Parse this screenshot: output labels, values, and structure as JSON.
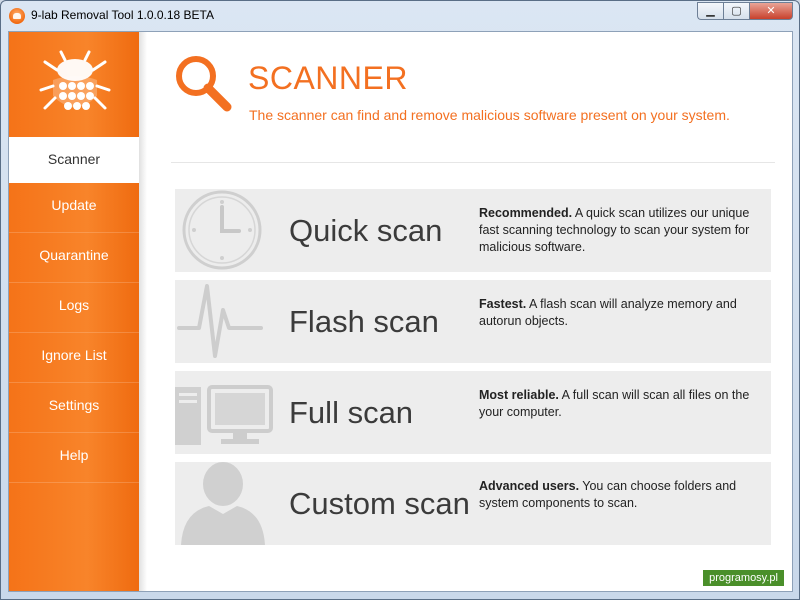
{
  "window": {
    "title": "9-lab Removal Tool 1.0.0.18 BETA",
    "minimize_glyph": "▁",
    "maximize_glyph": "▢",
    "close_glyph": "✕"
  },
  "sidebar": {
    "items": [
      {
        "label": "Scanner",
        "active": true
      },
      {
        "label": "Update",
        "active": false
      },
      {
        "label": "Quarantine",
        "active": false
      },
      {
        "label": "Logs",
        "active": false
      },
      {
        "label": "Ignore List",
        "active": false
      },
      {
        "label": "Settings",
        "active": false
      },
      {
        "label": "Help",
        "active": false
      }
    ]
  },
  "header": {
    "title": "SCANNER",
    "subtitle": "The scanner can find and remove malicious software present on your system."
  },
  "scans": [
    {
      "icon": "clock-icon",
      "name": "Quick scan",
      "lead": "Recommended.",
      "text": " A quick scan utilizes our unique fast scanning technology to scan your system for malicious software."
    },
    {
      "icon": "heartbeat-icon",
      "name": "Flash scan",
      "lead": "Fastest.",
      "text": " A flash scan will analyze memory and autorun objects."
    },
    {
      "icon": "computer-icon",
      "name": "Full scan",
      "lead": "Most reliable.",
      "text": " A full scan will scan all files on the your computer."
    },
    {
      "icon": "user-icon",
      "name": "Custom scan",
      "lead": "Advanced users.",
      "text": " You can choose folders and system components to scan."
    }
  ],
  "watermark": "programosy.pl",
  "colors": {
    "accent": "#f37021",
    "sidebar": "#f57318",
    "card": "#ededed"
  }
}
